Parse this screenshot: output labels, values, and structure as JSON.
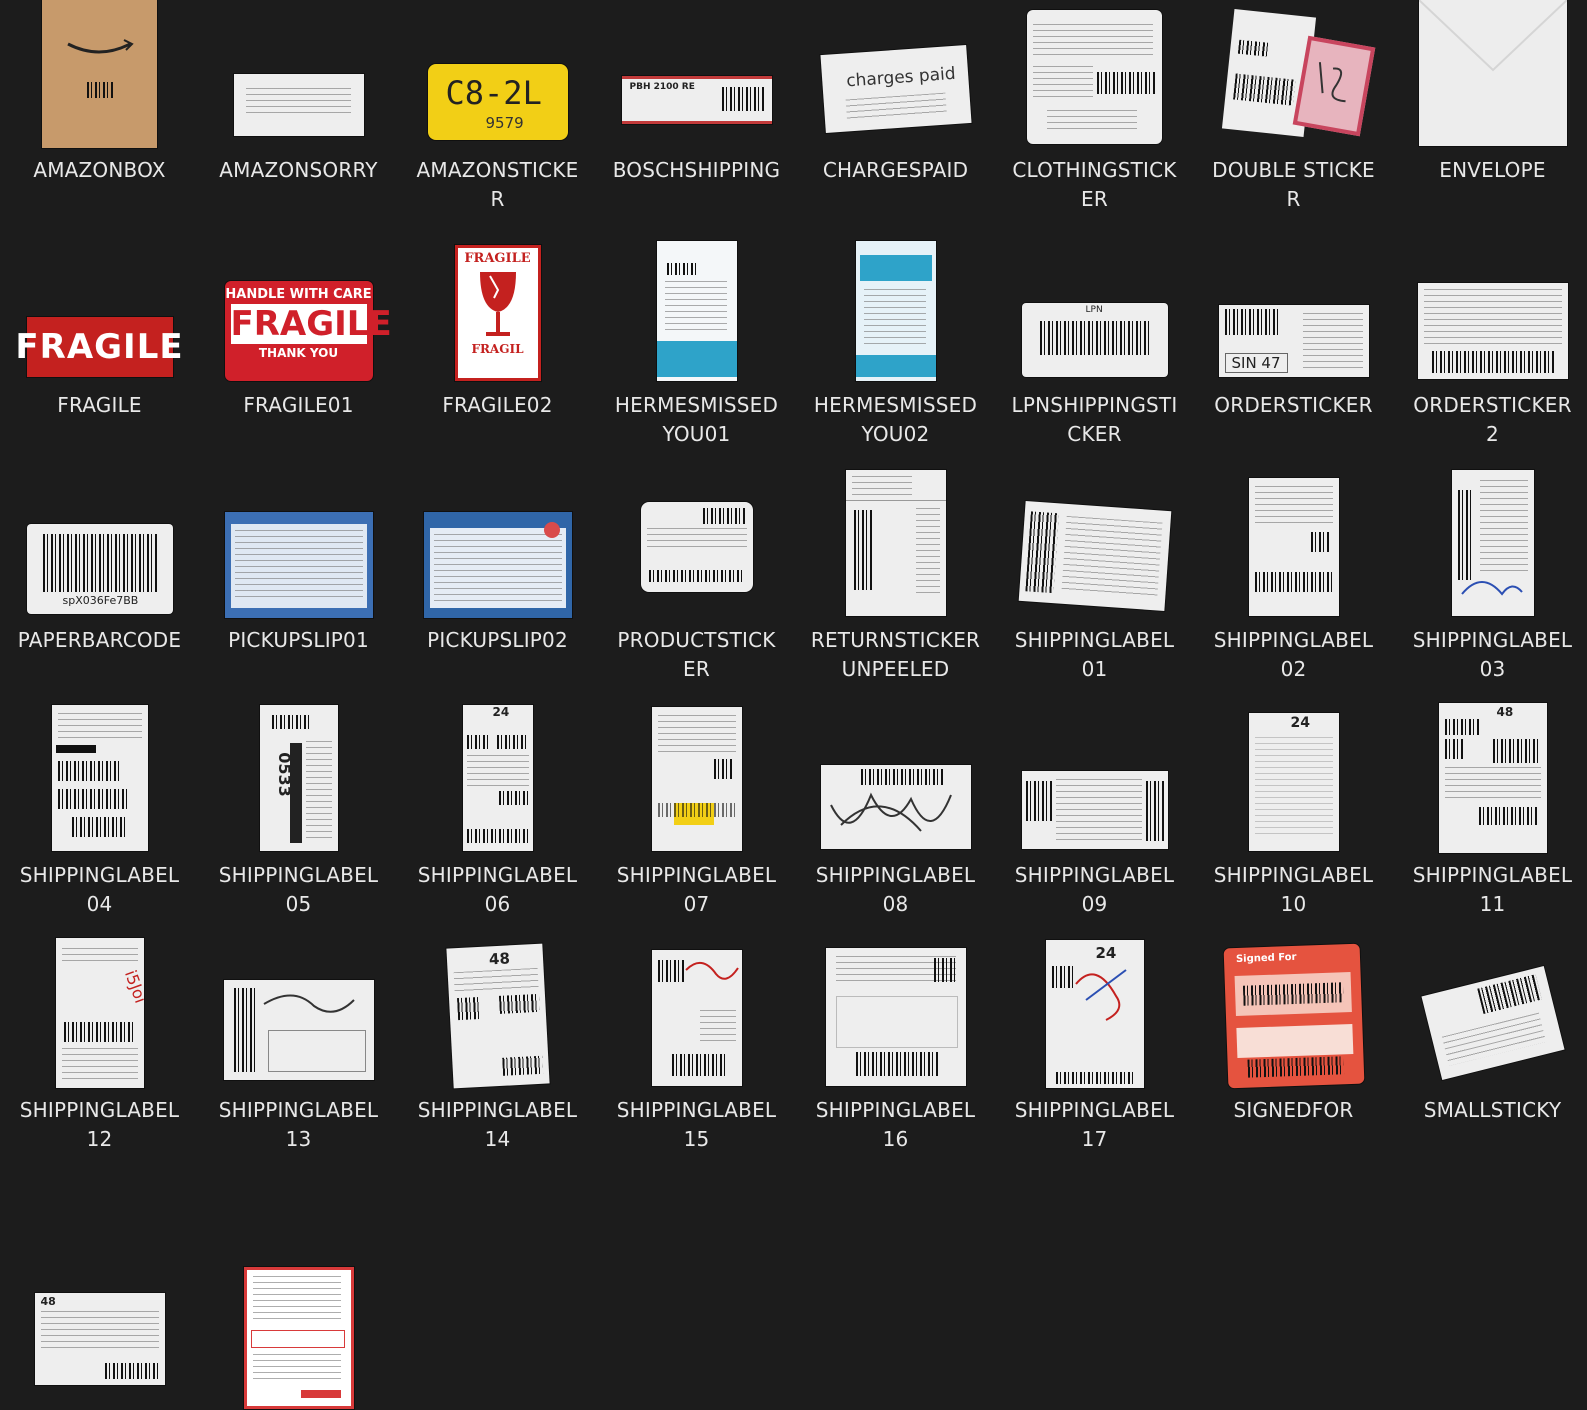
{
  "items": [
    {
      "label": "AMAZONBOX",
      "icon": "cardboard-box-icon"
    },
    {
      "label": "AMAZONSORRY",
      "icon": "white-label-icon"
    },
    {
      "label": "AMAZONSTICKER",
      "icon": "yellow-sticker-icon",
      "sticker_text": "C8-2L",
      "sticker_sub": "9579"
    },
    {
      "label": "BOSCHSHIPPING",
      "icon": "red-strip-label-icon",
      "sticker_text": "PBH 2100 RE"
    },
    {
      "label": "CHARGESPAID",
      "icon": "torn-label-icon",
      "sticker_text": "charges paid"
    },
    {
      "label": "CLOTHINGSTICKER",
      "icon": "clothing-label-icon"
    },
    {
      "label": "DOUBLE STICKER",
      "icon": "double-label-icon"
    },
    {
      "label": "ENVELOPE",
      "icon": "envelope-icon"
    },
    {
      "label": "FRAGILE",
      "icon": "fragile-label-icon",
      "sticker_text": "FRAGILE"
    },
    {
      "label": "FRAGILE01",
      "icon": "fragile-label-icon",
      "sticker_top": "HANDLE WITH CARE",
      "sticker_text": "FRAGILE",
      "sticker_bottom": "THANK YOU"
    },
    {
      "label": "FRAGILE02",
      "icon": "broken-glass-icon",
      "sticker_top": "FRAGILE",
      "sticker_bottom": "FRAGIL"
    },
    {
      "label": "HERMESMISSEDYOU01",
      "icon": "hermes-card-icon"
    },
    {
      "label": "HERMESMISSEDYOU02",
      "icon": "hermes-card-icon"
    },
    {
      "label": "LPNSHIPPINGSTICKER",
      "icon": "barcode-label-icon",
      "sticker_text": "LPN"
    },
    {
      "label": "ORDERSTICKER",
      "icon": "order-label-icon",
      "sticker_text": "SIN 47"
    },
    {
      "label": "ORDERSTICKER2",
      "icon": "order-label-icon"
    },
    {
      "label": "PAPERBARCODE",
      "icon": "barcode-label-icon",
      "sticker_text": "spX036Fe7BB"
    },
    {
      "label": "PICKUPSLIP01",
      "icon": "blue-slip-icon"
    },
    {
      "label": "PICKUPSLIP02",
      "icon": "blue-slip-icon"
    },
    {
      "label": "PRODUCTSTICKER",
      "icon": "product-label-icon"
    },
    {
      "label": "RETURNSTICKER UNPEELED",
      "icon": "return-label-icon"
    },
    {
      "label": "SHIPPINGLABEL01",
      "icon": "shipping-label-icon"
    },
    {
      "label": "SHIPPINGLABEL02",
      "icon": "shipping-label-icon"
    },
    {
      "label": "SHIPPINGLABEL03",
      "icon": "shipping-label-icon"
    },
    {
      "label": "SHIPPINGLABEL04",
      "icon": "shipping-label-icon"
    },
    {
      "label": "SHIPPINGLABEL05",
      "icon": "shipping-label-icon",
      "sticker_text": "0533"
    },
    {
      "label": "SHIPPINGLABEL06",
      "icon": "shipping-label-icon",
      "sticker_text": "24"
    },
    {
      "label": "SHIPPINGLABEL07",
      "icon": "shipping-label-icon"
    },
    {
      "label": "SHIPPINGLABEL08",
      "icon": "shipping-label-icon"
    },
    {
      "label": "SHIPPINGLABEL09",
      "icon": "shipping-label-icon"
    },
    {
      "label": "SHIPPINGLABEL10",
      "icon": "shipping-label-icon",
      "sticker_text": "24"
    },
    {
      "label": "SHIPPINGLABEL11",
      "icon": "shipping-label-icon",
      "sticker_text": "48"
    },
    {
      "label": "SHIPPINGLABEL12",
      "icon": "shipping-label-icon"
    },
    {
      "label": "SHIPPINGLABEL13",
      "icon": "shipping-label-icon"
    },
    {
      "label": "SHIPPINGLABEL14",
      "icon": "shipping-label-icon",
      "sticker_text": "48"
    },
    {
      "label": "SHIPPINGLABEL15",
      "icon": "shipping-label-icon"
    },
    {
      "label": "SHIPPINGLABEL16",
      "icon": "shipping-label-icon"
    },
    {
      "label": "SHIPPINGLABEL17",
      "icon": "shipping-label-icon",
      "sticker_text": "24"
    },
    {
      "label": "SIGNEDFOR",
      "icon": "signed-for-label-icon",
      "sticker_text": "Signed For"
    },
    {
      "label": "SMALLSTICKY",
      "icon": "small-sticky-icon"
    },
    {
      "label": "",
      "icon": "shipping-label-icon",
      "sticker_text": "48"
    },
    {
      "label": "",
      "icon": "red-form-icon"
    }
  ]
}
